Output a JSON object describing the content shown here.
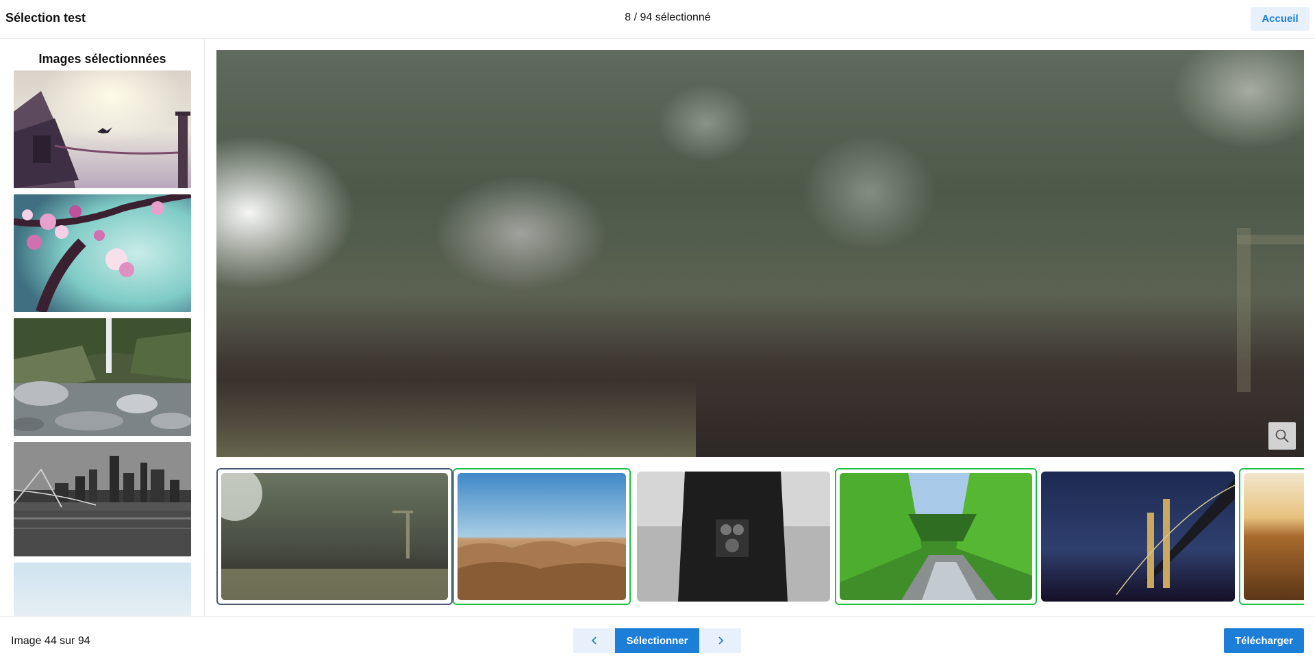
{
  "header": {
    "title": "Sélection test",
    "selection_count": "8 / 94 sélectionné",
    "home_label": "Accueil"
  },
  "sidebar": {
    "title": "Images sélectionnées",
    "thumbnails": [
      {
        "subject": "boat at sea with bird on mooring post"
      },
      {
        "subject": "pink cherry blossoms on turquoise background"
      },
      {
        "subject": "waterfall over rocky riverbed"
      },
      {
        "subject": "black and white city bridge at night"
      },
      {
        "subject": "pale blue sky"
      }
    ]
  },
  "viewer": {
    "subject": "blurred forest path with grass in foreground",
    "zoom_icon": "magnifier-icon"
  },
  "filmstrip": {
    "items": [
      {
        "subject": "forest path with grass",
        "state": "current"
      },
      {
        "subject": "rolling desert hills under blue sky",
        "state": "selected"
      },
      {
        "subject": "person holding twin-lens camera, black and white",
        "state": "none"
      },
      {
        "subject": "green forest valley with river",
        "state": "selected"
      },
      {
        "subject": "suspension bridge at night",
        "state": "none"
      },
      {
        "subject": "golden field at sunset",
        "state": "selected"
      }
    ]
  },
  "footer": {
    "counter": "Image 44 sur 94",
    "prev_icon": "chevron-left-icon",
    "select_label": "Sélectionner",
    "next_icon": "chevron-right-icon",
    "download_label": "Télécharger"
  },
  "colors": {
    "accent": "#1c7ed6",
    "accent_light": "#e8f1fb",
    "selected_border": "#22c046",
    "current_border": "#4a5a75"
  }
}
